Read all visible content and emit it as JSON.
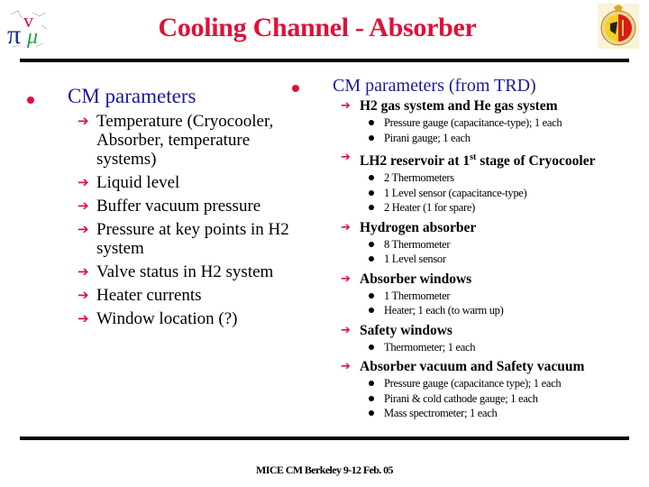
{
  "header": {
    "title": "Cooling Channel - Absorber",
    "logo_left": "mice-pi-nu-mu-logo",
    "logo_right": "geneva-university-seal"
  },
  "colors": {
    "title": "#e0103a",
    "heading": "#1a1a9a",
    "bullet": "#e0103a"
  },
  "left": {
    "heading": "CM parameters",
    "items": [
      "Temperature (Cryocooler, Absorber, temperature systems)",
      "Liquid level",
      "Buffer vacuum pressure",
      "Pressure at key points in H2 system",
      "Valve status in H2 system",
      "Heater currents",
      "Window location (?)"
    ]
  },
  "right": {
    "heading": "CM parameters (from TRD)",
    "groups": [
      {
        "title": "H2 gas system and He gas system",
        "items": [
          "Pressure gauge (capacitance-type); 1 each",
          "Pirani gauge; 1 each"
        ]
      },
      {
        "title_pre": "LH2 reservoir at 1",
        "title_sup": "st",
        "title_post": " stage of Cryocooler",
        "items": [
          "2 Thermometers",
          "1 Level sensor (capacitance-type)",
          "2 Heater (1 for spare)"
        ]
      },
      {
        "title": "Hydrogen absorber",
        "items": [
          "8 Thermometer",
          "1 Level sensor"
        ]
      },
      {
        "title": "Absorber windows",
        "items": [
          "1 Thermometer",
          "Heater; 1 each (to warm up)"
        ]
      },
      {
        "title": "Safety windows",
        "items": [
          "Thermometer; 1 each"
        ]
      },
      {
        "title": "Absorber vacuum and Safety vacuum",
        "items": [
          "Pressure gauge (capacitance type); 1 each",
          "Pirani & cold cathode gauge; 1 each",
          "Mass spectrometer; 1 each"
        ]
      }
    ]
  },
  "footer": {
    "text": "MICE CM Berkeley 9-12 Feb. 05"
  },
  "glyphs": {
    "arrow": "➔"
  }
}
